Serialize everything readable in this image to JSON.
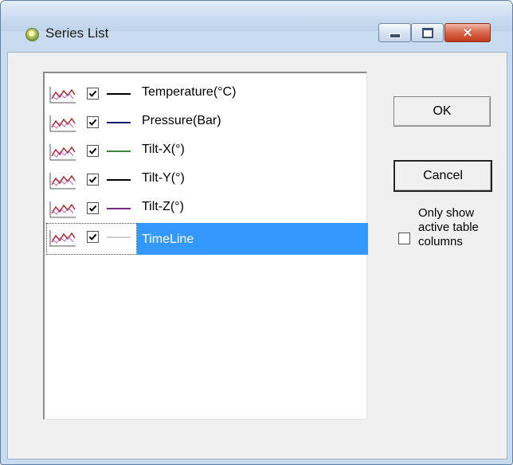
{
  "window": {
    "title": "Series List",
    "icon": "app-icon",
    "controls": {
      "minimize": "minimize-icon",
      "maximize": "maximize-icon",
      "close": "×"
    }
  },
  "series": [
    {
      "label": "Temperature(°C)",
      "checked": true,
      "color": "#000000"
    },
    {
      "label": "Pressure(Bar)",
      "checked": true,
      "color": "#1a1a6e"
    },
    {
      "label": "Tilt-X(°)",
      "checked": true,
      "color": "#3a8a3a"
    },
    {
      "label": "Tilt-Y(°)",
      "checked": true,
      "color": "#000000"
    },
    {
      "label": "Tilt-Z(°)",
      "checked": true,
      "color": "#7a2a8a"
    },
    {
      "label": "TimeLine",
      "checked": true,
      "color": "#cfcfcf",
      "selected": true
    }
  ],
  "buttons": {
    "ok": "OK",
    "cancel": "Cancel"
  },
  "options": {
    "only_active_label": "Only show active table columns",
    "only_active_checked": false
  },
  "colors": {
    "selection": "#3399ff",
    "titlebar": "#c9dcef"
  }
}
